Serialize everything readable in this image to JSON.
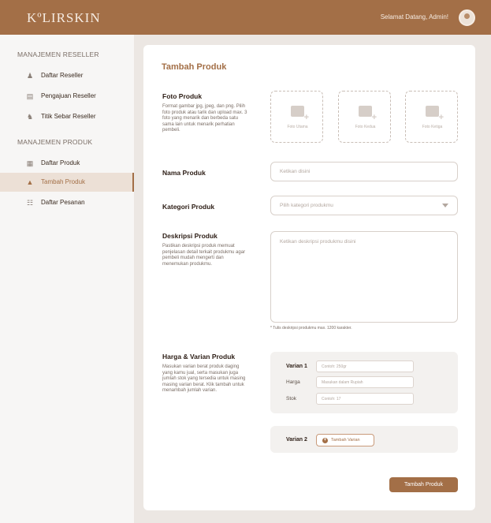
{
  "header": {
    "logo": "KºLIRSKIN",
    "greeting": "Selamat Datang, Admin!"
  },
  "sidebar": {
    "sections": [
      {
        "title": "MANAJEMEN RESELLER",
        "items": [
          {
            "label": "Daftar Reseller",
            "icon": "person-icon"
          },
          {
            "label": "Pengajuan Reseller",
            "icon": "document-icon"
          },
          {
            "label": "Titik Sebar Reseller",
            "icon": "group-icon"
          }
        ]
      },
      {
        "title": "MANAJEMEN PRODUK",
        "items": [
          {
            "label": "Daftar Produk",
            "icon": "grid-icon"
          },
          {
            "label": "Tambah Produk",
            "icon": "bag-icon",
            "active": true
          },
          {
            "label": "Daftar Pesanan",
            "icon": "list-icon"
          }
        ]
      }
    ]
  },
  "form": {
    "title": "Tambah Produk",
    "photo": {
      "label": "Foto Produk",
      "description": "Format gambar jpg, jpeg, dan png. Pilih foto produk atau tarik dan upload max. 3 foto yang menarik dan berbeda satu sama lain untuk menarik perhatian pembeli.",
      "slots": [
        "Foto Utama",
        "Foto Kedua",
        "Foto Ketiga"
      ]
    },
    "name": {
      "label": "Nama Produk",
      "placeholder": "Ketikan disini"
    },
    "category": {
      "label": "Kategori Produk",
      "placeholder": "Pilih kategori produkmu"
    },
    "description": {
      "label": "Deskripsi Produk",
      "description": "Pastikan deskripsi produk memuat penjelasan detail terkait produkmu agar pembeli mudah mengerti dan menemukan produkmu.",
      "placeholder": "Ketikan deskripsi produkmu disini",
      "helper": "* Tulis deskripsi produkmu max. 1200 karakter."
    },
    "variants": {
      "label": "Harga & Varian Produk",
      "description": "Masukan varian berat produk daging yang kamu jual, serta masukan juga jumlah stok yang tersedia untuk masing masing varian berat. Klik tambah untuk menambah jumlah varian.",
      "variant1": {
        "title": "Varian 1",
        "weight_placeholder": "Contoh: 250gr",
        "price_label": "Harga",
        "price_placeholder": "Masukan dalam Rupiah",
        "stock_label": "Stok",
        "stock_placeholder": "Contoh: 17"
      },
      "variant2": {
        "title": "Varian 2",
        "add_label": "Tambah Varian"
      }
    },
    "submit_label": "Tambah Produk"
  },
  "colors": {
    "brand": "#a36f47",
    "background": "#ece7e3",
    "sidebar": "#f7f6f5",
    "active_item": "#ece0d6"
  }
}
